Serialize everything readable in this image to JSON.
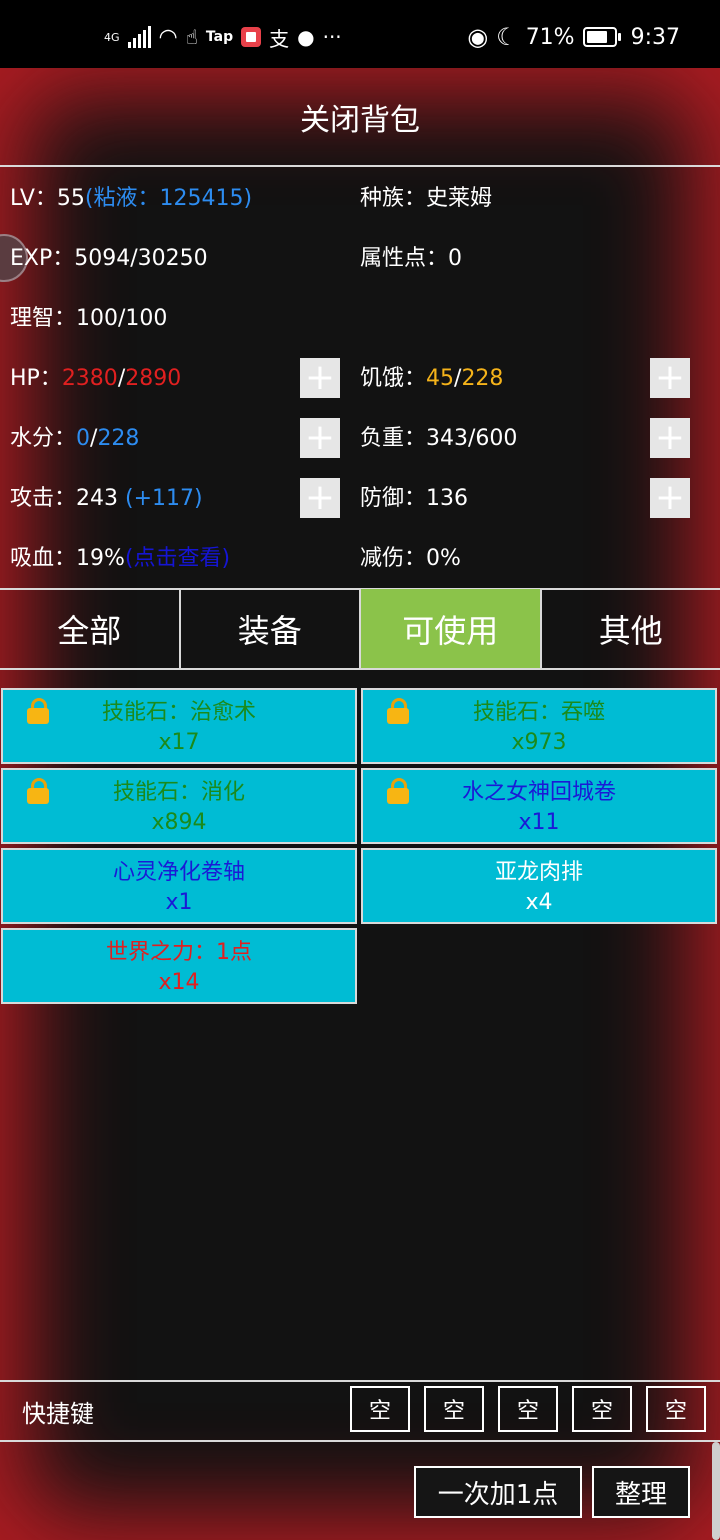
{
  "status_bar": {
    "network": "4G",
    "tap_label": "Tap",
    "alipay_glyph": "支",
    "more": "···",
    "battery": "71%",
    "time": "9:37"
  },
  "header": {
    "title": "关闭背包"
  },
  "stats": {
    "lv_label": "LV：",
    "lv_value": "55",
    "slime_text": "(粘液：125415)",
    "race_label": "种族：",
    "race_value": "史莱姆",
    "exp_label": "EXP：",
    "exp_value": "5094/30250",
    "attr_label": "属性点：",
    "attr_value": "0",
    "sanity_label": "理智：",
    "sanity_value": "100/100",
    "hp_label": "HP：",
    "hp_current": "2380",
    "hp_sep": "/",
    "hp_max": "2890",
    "hunger_label": "饥饿：",
    "hunger_current": "45",
    "hunger_sep": "/",
    "hunger_max": "228",
    "water_label": "水分：",
    "water_current": "0",
    "water_sep": "/",
    "water_max": "228",
    "load_label": "负重：",
    "load_value": "343/600",
    "attack_label": "攻击：",
    "attack_value": "243",
    "attack_bonus": "(+117)",
    "defense_label": "防御：",
    "defense_value": "136",
    "lifesteal_label": "吸血：",
    "lifesteal_value": "19%",
    "lifesteal_link": "(点击查看)",
    "reduction_label": "减伤：",
    "reduction_value": "0%",
    "plus": "+"
  },
  "tabs": [
    {
      "label": "全部",
      "active": false
    },
    {
      "label": "装备",
      "active": false
    },
    {
      "label": "可使用",
      "active": true
    },
    {
      "label": "其他",
      "active": false
    }
  ],
  "items": [
    {
      "name": "技能石：治愈术",
      "count": "x17",
      "locked": true,
      "color": "green"
    },
    {
      "name": "技能石：吞噬",
      "count": "x973",
      "locked": true,
      "color": "green"
    },
    {
      "name": "技能石：消化",
      "count": "x894",
      "locked": true,
      "color": "green"
    },
    {
      "name": "水之女神回城卷",
      "count": "x11",
      "locked": true,
      "color": "blue"
    },
    {
      "name": "心灵净化卷轴",
      "count": "x1",
      "locked": false,
      "color": "blue"
    },
    {
      "name": "亚龙肉排",
      "count": "x4",
      "locked": false,
      "color": "white"
    },
    {
      "name": "世界之力：1点",
      "count": "x14",
      "locked": false,
      "color": "red"
    }
  ],
  "quick_bar": {
    "label": "快捷键",
    "slots": [
      "空",
      "空",
      "空",
      "空",
      "空"
    ]
  },
  "footer": {
    "add_one_label": "一次加1点",
    "sort_label": "整理"
  },
  "colors": {
    "accent_tab": "#8bc34a",
    "item_bg": "#00bcd4",
    "frame_glow": "#b01c22"
  }
}
